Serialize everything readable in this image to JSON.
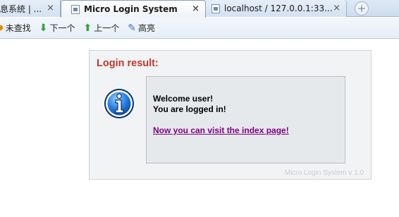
{
  "tabs": [
    {
      "label": "息系统 | ...",
      "close": "×",
      "active": false
    },
    {
      "label": "Micro Login System",
      "close": "×",
      "active": true
    },
    {
      "label": "localhost / 127.0.0.1:33...",
      "close": "×",
      "active": false
    }
  ],
  "new_tab_icon": "+",
  "findbar": {
    "not_found": "未查找",
    "next": "下一个",
    "prev": "上一个",
    "highlight": "高亮"
  },
  "login": {
    "title": "Login result:",
    "welcome": "Welcome user!",
    "logged_in": "You are logged in!",
    "link": "Now you can visit the index page!",
    "version": "Micro Login System v 1.0"
  },
  "colors": {
    "title_red": "#c0392b",
    "link_visited": "#800080",
    "info_blue": "#1f6fd1"
  }
}
